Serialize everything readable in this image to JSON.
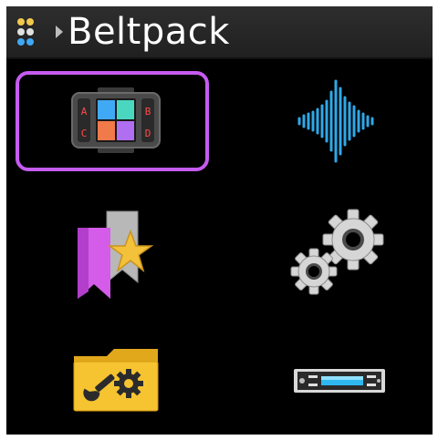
{
  "header": {
    "title": "Beltpack",
    "menu_icon": "dots-grid-icon",
    "breadcrumb_icon": "chevron-right-icon"
  },
  "colors": {
    "selection_border": "#c65bf0",
    "header_bg": "#282828",
    "screen_bg": "#000000"
  },
  "menu": {
    "items": [
      {
        "icon": "channel-keys-abcd-icon",
        "selected": true
      },
      {
        "icon": "audio-waveform-icon",
        "selected": false
      },
      {
        "icon": "favorite-bookmark-star-icon",
        "selected": false
      },
      {
        "icon": "settings-gears-icon",
        "selected": false
      },
      {
        "icon": "tools-folder-icon",
        "selected": false
      },
      {
        "icon": "rack-device-icon",
        "selected": false
      }
    ],
    "channel_keys": {
      "a": "A",
      "b": "B",
      "c": "C",
      "d": "D"
    }
  }
}
